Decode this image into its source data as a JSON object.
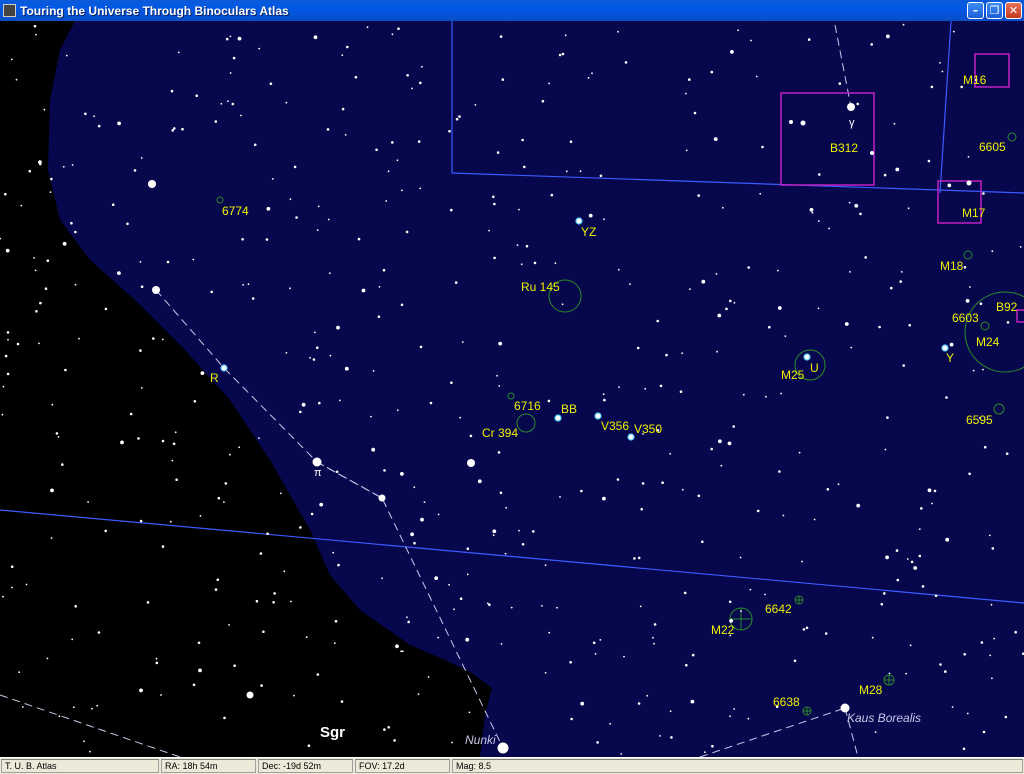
{
  "window": {
    "title": "Touring the Universe Through Binoculars Atlas",
    "minimize_glyph": "–",
    "restore_glyph": "❐",
    "close_glyph": "✕"
  },
  "colors": {
    "sky_in": "#07074e",
    "sky_out": "#000000",
    "star": "#ffffff",
    "label": "#f0f000",
    "cluster": "#2a8a2a",
    "variable": "#55ccff",
    "nebula_box": "#c020c0",
    "grid": "#3b5bff"
  },
  "map": {
    "constellation_label": "Sgr",
    "star_labels": {
      "gamma": "γ",
      "pi": "π",
      "nunki": "Nunki",
      "kaus_borealis": "Kaus Borealis"
    },
    "variable_labels": [
      "YZ",
      "R",
      "BB",
      "V356",
      "V350",
      "U",
      "Y"
    ],
    "object_labels": [
      "6774",
      "Ru 145",
      "6716",
      "Cr 394",
      "M25",
      "6603",
      "M24",
      "B92",
      "M18",
      "6595",
      "6605",
      "M17",
      "M16",
      "B312",
      "M22",
      "6642",
      "M28",
      "6638"
    ]
  },
  "status": {
    "app": "T. U. B. Atlas",
    "ra": "RA: 18h 54m",
    "dec": "Dec: -19d 52m",
    "fov": "FOV: 17.2d",
    "mag": "Mag: 8.5"
  }
}
